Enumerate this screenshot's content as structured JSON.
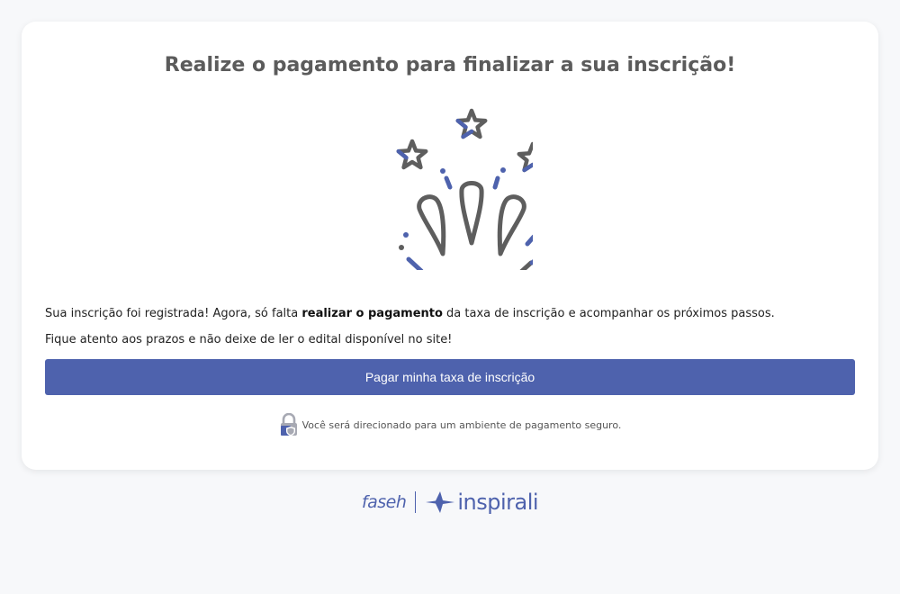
{
  "card": {
    "title": "Realize o pagamento para finalizar a sua inscrição!",
    "illustration_icon": "fireworks-celebration-icon",
    "message_line1": {
      "before": "Sua inscrição foi registrada! Agora, só falta ",
      "bold": "realizar o pagamento",
      "after": " da taxa de inscrição e acompanhar os próximos passos."
    },
    "message_line2": "Fique atento aos prazos e não deixe de ler o edital disponível no site!",
    "pay_button_label": "Pagar minha taxa de inscrição",
    "secure_icon": "secure-lock-shield-icon",
    "secure_text": "Você será direcionado para um ambiente de pagamento seguro."
  },
  "footer": {
    "logo1": "faseh",
    "logo2": "inspirali"
  },
  "colors": {
    "accent": "#4e62ad",
    "illustration_gray": "#5e5e5e",
    "background": "#f7f8fa",
    "title": "#5b5b5b"
  }
}
